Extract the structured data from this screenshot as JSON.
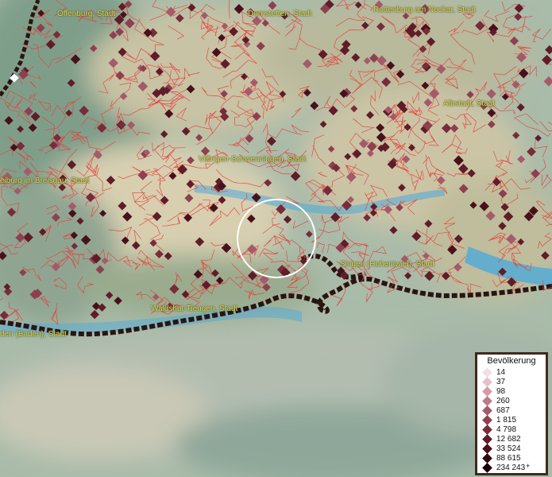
{
  "map": {
    "colors": {
      "water": "#4fa9d8",
      "boundary": "#e8403a",
      "border": "#2a1410",
      "label": "#e2d84a",
      "marker": "#6b1c24"
    },
    "cities": [
      {
        "id": "offenburg",
        "name": "Offenburg, Stadt"
      },
      {
        "id": "dornstetten",
        "name": "Dornstetten, Stadt"
      },
      {
        "id": "rottenburg",
        "name": "Rottenburg am Neckar, Stadt"
      },
      {
        "id": "albstadt",
        "name": "Albstadt, Stadt"
      },
      {
        "id": "villingen",
        "name": "Villingen-Schwenningen, Stadt"
      },
      {
        "id": "freiburg",
        "name": "eiburg im Breisgau, Stadt"
      },
      {
        "id": "singen",
        "name": "Singen (Hohentwiel), Stadt"
      },
      {
        "id": "waldshut",
        "name": "Waldshut-Tiengen, Stadt"
      },
      {
        "id": "baden",
        "name": "den (Baden), Stadt"
      }
    ]
  },
  "legend": {
    "title": "Bevölkerung",
    "items": [
      {
        "label": "14",
        "color": "#f3dfe6"
      },
      {
        "label": "37",
        "color": "#e8c0cb"
      },
      {
        "label": "98",
        "color": "#d49aa8"
      },
      {
        "label": "260",
        "color": "#bd7a88"
      },
      {
        "label": "687",
        "color": "#a55a69"
      },
      {
        "label": "1 815",
        "color": "#8e404f"
      },
      {
        "label": "4 798",
        "color": "#782c3a"
      },
      {
        "label": "12 682",
        "color": "#601c28"
      },
      {
        "label": "33 524",
        "color": "#48101b"
      },
      {
        "label": "88 615",
        "color": "#300810"
      },
      {
        "label": "234 243",
        "color": "#190308"
      }
    ],
    "overflow_marker": "+"
  }
}
